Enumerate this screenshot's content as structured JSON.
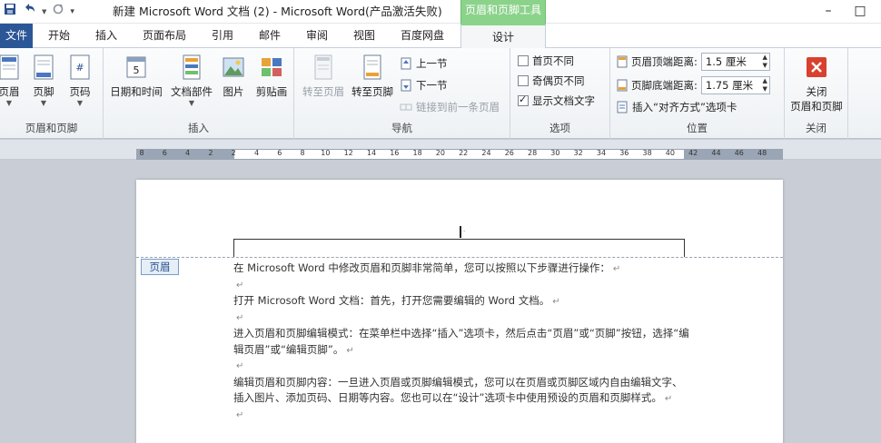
{
  "window": {
    "title": "新建 Microsoft Word 文档 (2)  -  Microsoft Word(产品激活失败)",
    "context_tab_title": "页眉和页脚工具",
    "minimize": "–",
    "maximize": "□"
  },
  "tabs": [
    "开始",
    "插入",
    "页面布局",
    "引用",
    "邮件",
    "审阅",
    "视图",
    "百度网盘"
  ],
  "file_tab": "文件",
  "active_tab": "设计",
  "ribbon": {
    "groups": {
      "header_footer": {
        "label": "页眉和页脚",
        "buttons": [
          "页眉",
          "页脚",
          "页码"
        ]
      },
      "insert": {
        "label": "插入",
        "buttons": [
          "日期和时间",
          "文档部件",
          "图片",
          "剪贴画"
        ]
      },
      "navigation": {
        "label": "导航",
        "goto_header": "转至页眉",
        "goto_footer": "转至页脚",
        "prev_section": "上一节",
        "next_section": "下一节",
        "link_previous": "链接到前一条页眉"
      },
      "options": {
        "label": "选项",
        "different_first": "首页不同",
        "different_odd_even": "奇偶页不同",
        "show_document_text": "显示文档文字"
      },
      "position": {
        "label": "位置",
        "header_from_top_label": "页眉顶端距离:",
        "header_from_top_value": "1.5 厘米",
        "footer_from_bottom_label": "页脚底端距离:",
        "footer_from_bottom_value": "1.75 厘米",
        "insert_alignment_tab": "插入“对齐方式”选项卡"
      },
      "close": {
        "label": "关闭",
        "button_line1": "关闭",
        "button_line2": "页眉和页脚"
      }
    }
  },
  "ruler": {
    "ticks": [
      "8",
      "6",
      "4",
      "2",
      "2",
      "4",
      "6",
      "8",
      "10",
      "12",
      "14",
      "16",
      "18",
      "20",
      "22",
      "24",
      "26",
      "28",
      "30",
      "32",
      "34",
      "36",
      "38",
      "40",
      "42",
      "44",
      "46",
      "48"
    ]
  },
  "document": {
    "header_tag": "页眉",
    "paragraphs": [
      "在 Microsoft Word 中修改页眉和页脚非常简单，您可以按照以下步骤进行操作：",
      "",
      "打开 Microsoft Word 文档：首先，打开您需要编辑的 Word 文档。",
      "",
      "进入页眉和页脚编辑模式：在菜单栏中选择“插入”选项卡，然后点击“页眉”或“页脚”按钮，选择“编辑页眉”或“编辑页脚”。",
      "",
      "编辑页眉和页脚内容：一旦进入页眉或页脚编辑模式，您可以在页眉或页脚区域内自由编辑文字、插入图片、添加页码、日期等内容。您也可以在“设计”选项卡中使用预设的页眉和页脚样式。",
      ""
    ]
  },
  "icons": [
    "save-icon",
    "undo-icon",
    "redo-icon",
    "customize-qat-icon"
  ],
  "colors": {
    "file_tab": "#2b5797",
    "context_tab": "#8bd28b"
  }
}
